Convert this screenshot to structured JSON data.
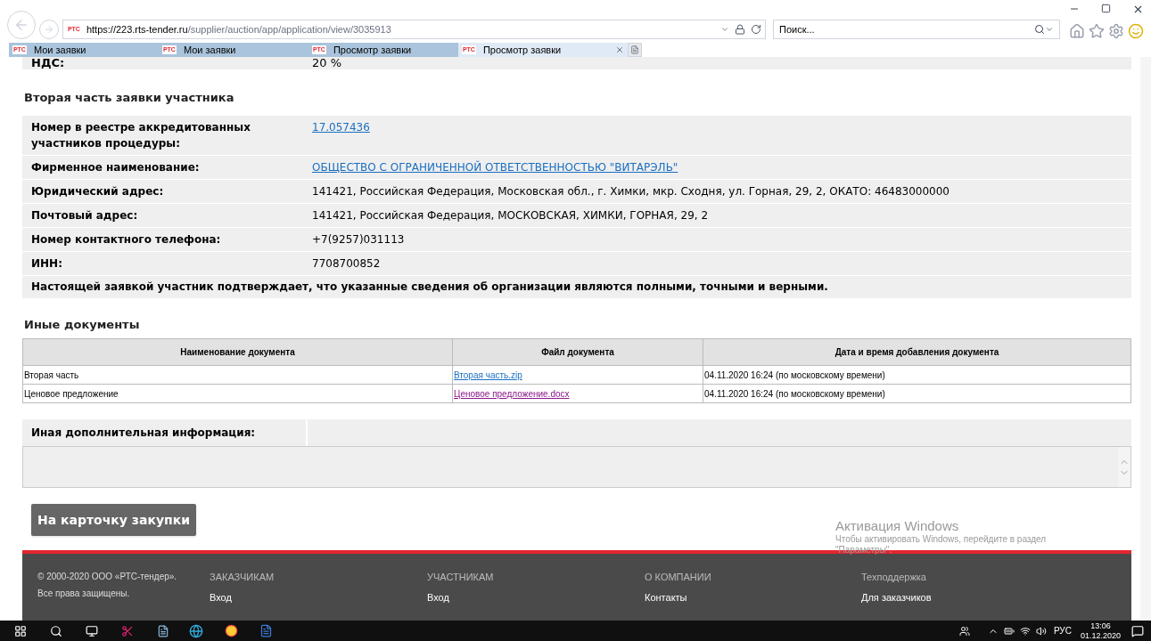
{
  "browser": {
    "url_host": "https://223.rts-tender.ru",
    "url_path": "/supplier/auction/app/application/view/3035913",
    "search": {
      "placeholder": "Поиск..."
    },
    "favicon": "РТС",
    "tabs": [
      {
        "favicon": "РТС",
        "label": "Мои заявки",
        "selected": false
      },
      {
        "favicon": "РТС",
        "label": "Мои заявки",
        "selected": false
      },
      {
        "favicon": "РТС",
        "label": "Просмотр заявки",
        "selected": false
      },
      {
        "favicon": "РТС",
        "label": "Просмотр заявки",
        "selected": true
      }
    ]
  },
  "top_row": {
    "label": "НДС:",
    "value": "20 %"
  },
  "second_part": {
    "title": "Вторая часть заявки участника",
    "rows": [
      {
        "label": "Номер в реестре аккредитованных участников процедуры:",
        "value": "17.057436",
        "kind": "link"
      },
      {
        "label": "Фирменное наименование:",
        "value": "ОБЩЕСТВО С ОГРАНИЧЕННОЙ ОТВЕТСТВЕННОСТЬЮ \"ВИТАРЭЛЬ\"",
        "kind": "link"
      },
      {
        "label": "Юридический адрес:",
        "value": "141421, Российская Федерация, Московская обл., г. Химки, мкр. Сходня, ул. Горная, 29, 2, ОКАТО: 46483000000",
        "kind": "text"
      },
      {
        "label": "Почтовый адрес:",
        "value": "141421, Российская Федерация, МОСКОВСКАЯ, ХИМКИ, ГОРНАЯ, 29, 2",
        "kind": "text"
      },
      {
        "label": "Номер контактного телефона:",
        "value": "+7(9257)031113",
        "kind": "text"
      },
      {
        "label": "ИНН:",
        "value": "7708700852",
        "kind": "text"
      }
    ],
    "statement": "Настоящей заявкой участник подтверждает, что указанные сведения об организации являются полными, точными и верными."
  },
  "other_documents": {
    "title": "Иные документы",
    "columns": [
      "Наименование документа",
      "Файл документа",
      "Дата и время добавления документа"
    ],
    "rows": [
      {
        "name": "Вторая часть",
        "file": "Вторая часть.zip",
        "visited": false,
        "date": "04.11.2020 16:24 (по московскому времени)"
      },
      {
        "name": "Ценовое предложение",
        "file": "Ценовое предложение.docx",
        "visited": true,
        "date": "04.11.2020 16:24 (по московскому времени)"
      }
    ]
  },
  "additional_info": {
    "label": "Иная дополнительная информация:"
  },
  "back_button": "На карточку закупки",
  "activation": {
    "title": "Активация Windows",
    "text": "Чтобы активировать Windows, перейдите в раздел \"Параметры\"."
  },
  "footer": {
    "copyright": [
      "© 2000-2020 ООО «РТС-тендер».",
      "Все права защищены."
    ],
    "columns": [
      {
        "heading": "ЗАКАЗЧИКАМ",
        "link": "Вход"
      },
      {
        "heading": "УЧАСТНИКАМ",
        "link": "Вход"
      },
      {
        "heading": "О КОМПАНИИ",
        "link": "Контакты"
      },
      {
        "heading": "Техподдержка",
        "link": "Для заказчиков"
      }
    ]
  },
  "taskbar": {
    "language": "РУС",
    "time": "13:06",
    "date": "01.12.2020"
  }
}
